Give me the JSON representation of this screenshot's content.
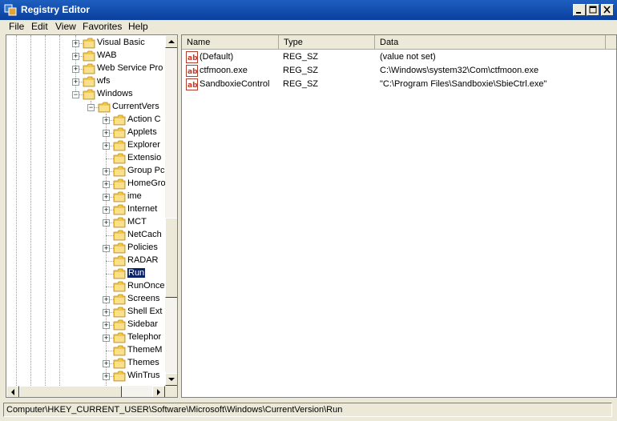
{
  "window": {
    "title": "Registry Editor"
  },
  "menu": [
    "File",
    "Edit",
    "View",
    "Favorites",
    "Help"
  ],
  "tree": {
    "items": [
      {
        "label": "Visual Basic",
        "level": 0,
        "expander": "+"
      },
      {
        "label": "WAB",
        "level": 0,
        "expander": "+"
      },
      {
        "label": "Web Service Pro",
        "level": 0,
        "expander": "+"
      },
      {
        "label": "wfs",
        "level": 0,
        "expander": "+"
      },
      {
        "label": "Windows",
        "level": 0,
        "expander": "−"
      },
      {
        "label": "CurrentVers",
        "level": 1,
        "expander": "−"
      },
      {
        "label": "Action C",
        "level": 2,
        "expander": "+"
      },
      {
        "label": "Applets",
        "level": 2,
        "expander": "+"
      },
      {
        "label": "Explorer",
        "level": 2,
        "expander": "+"
      },
      {
        "label": "Extensio",
        "level": 2,
        "expander": ""
      },
      {
        "label": "Group Pc",
        "level": 2,
        "expander": "+"
      },
      {
        "label": "HomeGro",
        "level": 2,
        "expander": "+"
      },
      {
        "label": "ime",
        "level": 2,
        "expander": "+"
      },
      {
        "label": "Internet",
        "level": 2,
        "expander": "+"
      },
      {
        "label": "MCT",
        "level": 2,
        "expander": "+"
      },
      {
        "label": "NetCach",
        "level": 2,
        "expander": ""
      },
      {
        "label": "Policies",
        "level": 2,
        "expander": "+"
      },
      {
        "label": "RADAR",
        "level": 2,
        "expander": ""
      },
      {
        "label": "Run",
        "level": 2,
        "expander": "",
        "selected": true
      },
      {
        "label": "RunOnce",
        "level": 2,
        "expander": ""
      },
      {
        "label": "Screens",
        "level": 2,
        "expander": "+"
      },
      {
        "label": "Shell Ext",
        "level": 2,
        "expander": "+"
      },
      {
        "label": "Sidebar",
        "level": 2,
        "expander": "+"
      },
      {
        "label": "Telephor",
        "level": 2,
        "expander": "+"
      },
      {
        "label": "ThemeM",
        "level": 2,
        "expander": ""
      },
      {
        "label": "Themes",
        "level": 2,
        "expander": "+"
      },
      {
        "label": "WinTrus",
        "level": 2,
        "expander": "+"
      }
    ]
  },
  "values": {
    "columns": [
      "Name",
      "Type",
      "Data"
    ],
    "rows": [
      {
        "name": "(Default)",
        "type": "REG_SZ",
        "data": "(value not set)"
      },
      {
        "name": "ctfmoon.exe",
        "type": "REG_SZ",
        "data": "C:\\Windows\\system32\\Com\\ctfmoon.exe"
      },
      {
        "name": "SandboxieControl",
        "type": "REG_SZ",
        "data": "\"C:\\Program Files\\Sandboxie\\SbieCtrl.exe\""
      }
    ]
  },
  "status": {
    "path": "Computer\\HKEY_CURRENT_USER\\Software\\Microsoft\\Windows\\CurrentVersion\\Run"
  },
  "colors": {
    "titlebar": "#0a3f9e",
    "selection": "#0a246a",
    "folder": "#f5c84a"
  }
}
